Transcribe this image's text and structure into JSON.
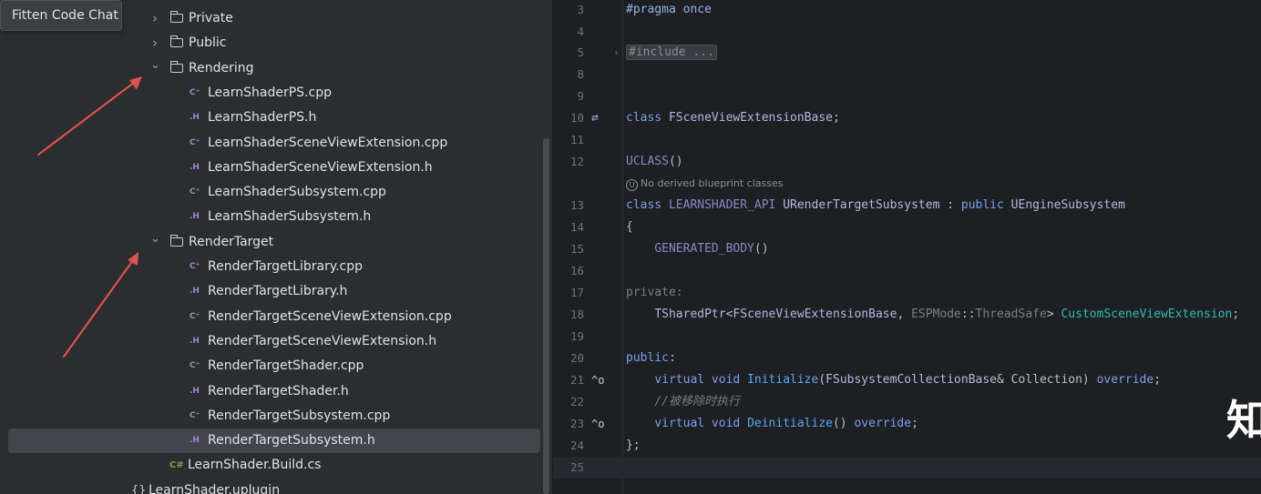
{
  "tooltip": {
    "label": "Fitten Code Chat"
  },
  "tree": {
    "items": [
      {
        "kind": "folder",
        "label": "Private",
        "expanded": false,
        "icon": "folder-icon"
      },
      {
        "kind": "folder",
        "label": "Public",
        "expanded": false,
        "icon": "folder-icon"
      },
      {
        "kind": "folder",
        "label": "Rendering",
        "expanded": true,
        "icon": "folder-icon"
      },
      {
        "kind": "file",
        "type": "cpp",
        "type_label": "C⁺",
        "label": "LearnShaderPS.cpp"
      },
      {
        "kind": "file",
        "type": "h",
        "type_label": ".H",
        "label": "LearnShaderPS.h"
      },
      {
        "kind": "file",
        "type": "cpp",
        "type_label": "C⁺",
        "label": "LearnShaderSceneViewExtension.cpp"
      },
      {
        "kind": "file",
        "type": "h",
        "type_label": ".H",
        "label": "LearnShaderSceneViewExtension.h"
      },
      {
        "kind": "file",
        "type": "cpp",
        "type_label": "C⁺",
        "label": "LearnShaderSubsystem.cpp"
      },
      {
        "kind": "file",
        "type": "h",
        "type_label": ".H",
        "label": "LearnShaderSubsystem.h"
      },
      {
        "kind": "folder",
        "label": "RenderTarget",
        "expanded": true,
        "icon": "folder-icon"
      },
      {
        "kind": "file",
        "type": "cpp",
        "type_label": "C⁺",
        "label": "RenderTargetLibrary.cpp"
      },
      {
        "kind": "file",
        "type": "h",
        "type_label": ".H",
        "label": "RenderTargetLibrary.h"
      },
      {
        "kind": "file",
        "type": "cpp",
        "type_label": "C⁺",
        "label": "RenderTargetSceneViewExtension.cpp"
      },
      {
        "kind": "file",
        "type": "h",
        "type_label": ".H",
        "label": "RenderTargetSceneViewExtension.h"
      },
      {
        "kind": "file",
        "type": "cpp",
        "type_label": "C⁺",
        "label": "RenderTargetShader.cpp"
      },
      {
        "kind": "file",
        "type": "h",
        "type_label": ".H",
        "label": "RenderTargetShader.h"
      },
      {
        "kind": "file",
        "type": "cpp",
        "type_label": "C⁺",
        "label": "RenderTargetSubsystem.cpp"
      },
      {
        "kind": "file",
        "type": "h",
        "type_label": ".H",
        "label": "RenderTargetSubsystem.h",
        "selected": true
      },
      {
        "kind": "file",
        "type": "cs",
        "type_label": "C#",
        "label": "LearnShader.Build.cs"
      },
      {
        "kind": "file",
        "type": "plugin",
        "type_label": "{}",
        "label": "LearnShader.uplugin"
      }
    ]
  },
  "editor": {
    "inlay_hint": "No derived blueprint classes",
    "inlay_hint_icon": "unreal-icon",
    "lines": [
      {
        "n": "3",
        "tokens": [
          [
            "t-pp",
            "#pragma once"
          ]
        ]
      },
      {
        "n": "4",
        "tokens": []
      },
      {
        "n": "5",
        "fold": "›",
        "tokens": [
          [
            "collapsed",
            "#include ..."
          ]
        ]
      },
      {
        "n": "8",
        "tokens": []
      },
      {
        "n": "9",
        "tokens": []
      },
      {
        "n": "10",
        "gutter": "⇄",
        "gutter_name": "related-symbol-icon",
        "tokens": [
          [
            "t-kw2",
            "class "
          ],
          [
            "t-cls",
            "FSceneViewExtensionBase"
          ],
          [
            "t-plain",
            ";"
          ]
        ]
      },
      {
        "n": "11",
        "tokens": []
      },
      {
        "n": "12",
        "tokens": [
          [
            "t-mac",
            "UCLASS"
          ],
          [
            "t-plain",
            "()"
          ]
        ]
      },
      {
        "n": "13",
        "tokens": [
          [
            "t-kw2",
            "class "
          ],
          [
            "t-mac",
            "LEARNSHADER_API "
          ],
          [
            "t-cls",
            "URenderTargetSubsystem"
          ],
          [
            "t-plain",
            " : "
          ],
          [
            "t-kw2",
            "public "
          ],
          [
            "t-cls",
            "UEngineSubsystem"
          ]
        ]
      },
      {
        "n": "14",
        "tokens": [
          [
            "t-plain",
            "{"
          ]
        ]
      },
      {
        "n": "15",
        "tokens": [
          [
            "t-plain",
            "    "
          ],
          [
            "t-mac",
            "GENERATED_BODY"
          ],
          [
            "t-plain",
            "()"
          ]
        ]
      },
      {
        "n": "16",
        "tokens": []
      },
      {
        "n": "17",
        "tokens": [
          [
            "t-gray",
            "private:"
          ]
        ]
      },
      {
        "n": "18",
        "tokens": [
          [
            "t-plain",
            "    "
          ],
          [
            "t-cls",
            "TSharedPtr"
          ],
          [
            "t-plain",
            "<"
          ],
          [
            "t-cls",
            "FSceneViewExtensionBase"
          ],
          [
            "t-plain",
            ", "
          ],
          [
            "t-gray",
            "ESPMode"
          ],
          [
            "t-plain",
            "::"
          ],
          [
            "t-gray",
            "ThreadSafe"
          ],
          [
            "t-plain",
            "> "
          ],
          [
            "t-teal",
            "CustomSceneViewExtension"
          ],
          [
            "t-plain",
            ";"
          ]
        ]
      },
      {
        "n": "19",
        "tokens": []
      },
      {
        "n": "20",
        "tokens": [
          [
            "t-kw2",
            "public"
          ],
          [
            "t-plain",
            ":"
          ]
        ]
      },
      {
        "n": "21",
        "gutter": "^o",
        "gutter_name": "override-icon",
        "tokens": [
          [
            "t-plain",
            "    "
          ],
          [
            "t-kw2",
            "virtual void "
          ],
          [
            "t-fn",
            "Initialize"
          ],
          [
            "t-plain",
            "("
          ],
          [
            "t-cls",
            "FSubsystemCollectionBase"
          ],
          [
            "t-plain",
            "& Collection) "
          ],
          [
            "t-kw2",
            "override"
          ],
          [
            "t-plain",
            ";"
          ]
        ]
      },
      {
        "n": "22",
        "tokens": [
          [
            "t-plain",
            "    "
          ],
          [
            "t-cmt",
            "//被移除时执行"
          ]
        ]
      },
      {
        "n": "23",
        "gutter": "^o",
        "gutter_name": "override-icon",
        "tokens": [
          [
            "t-plain",
            "    "
          ],
          [
            "t-kw2",
            "virtual void "
          ],
          [
            "t-fn",
            "Deinitialize"
          ],
          [
            "t-plain",
            "() "
          ],
          [
            "t-kw2",
            "override"
          ],
          [
            "t-plain",
            ";"
          ]
        ]
      },
      {
        "n": "24",
        "tokens": [
          [
            "t-plain",
            "};"
          ]
        ]
      },
      {
        "n": "25",
        "current": true,
        "tokens": []
      }
    ]
  },
  "watermark": {
    "text": "知"
  },
  "colors": {
    "arrow": "#d9534f",
    "selection": "#43454a",
    "accent": "#56a8f5"
  }
}
